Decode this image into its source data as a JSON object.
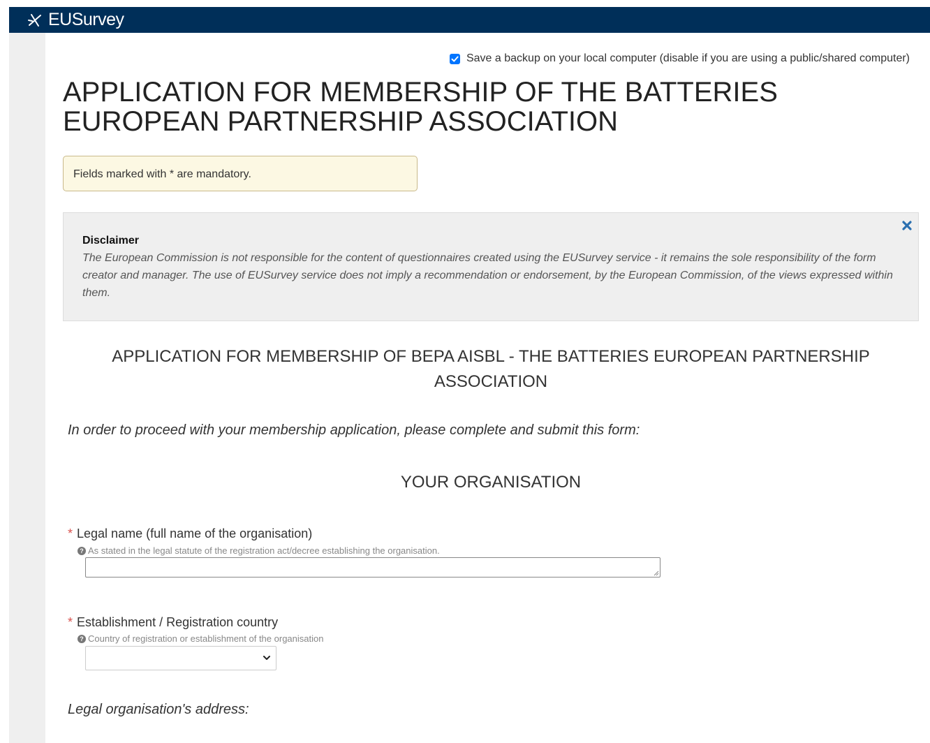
{
  "header": {
    "logo_text": "EUSurvey",
    "logo_icon": "eusurvey-star-icon",
    "background_color": "#002f59"
  },
  "backup": {
    "checked": true,
    "label": "Save a backup on your local computer (disable if you are using a public/shared computer)"
  },
  "survey": {
    "title": "APPLICATION FOR MEMBERSHIP OF THE BATTERIES EUROPEAN PARTNERSHIP ASSOCIATION",
    "mandatory_note": "Fields marked with * are mandatory."
  },
  "disclaimer": {
    "title": "Disclaimer",
    "text": "The European Commission is not responsible for the content of questionnaires created using the EUSurvey service - it remains the sole responsibility of the form creator and manager. The use of EUSurvey service does not imply a recommendation or endorsement, by the European Commission, of the views expressed within them.",
    "close_icon": "close-icon"
  },
  "form": {
    "section_title": "APPLICATION FOR MEMBERSHIP OF BEPA AISBL - THE BATTERIES EUROPEAN PARTNERSHIP ASSOCIATION",
    "intro": "In order to proceed with your membership application, please complete and submit this form:",
    "org_section_title": "YOUR ORGANISATION",
    "required_marker": "*",
    "legal_name": {
      "label": "Legal name (full name of the organisation)",
      "help": "As stated in the legal statute of the registration act/decree establishing the organisation.",
      "value": ""
    },
    "country": {
      "label": "Establishment / Registration country",
      "help": "Country of registration or establishment of the organisation",
      "selected": ""
    },
    "address_label": "Legal organisation's address:"
  }
}
